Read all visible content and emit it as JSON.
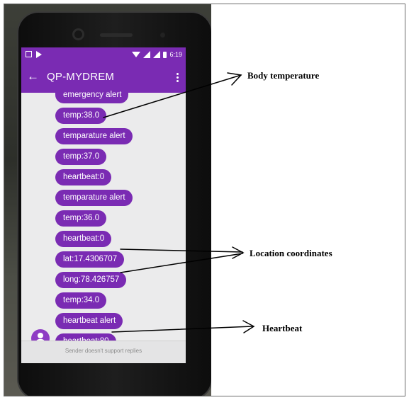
{
  "app": {
    "title": "QP-MYDREM",
    "clock": "6:19",
    "back_icon": "arrow-left-icon",
    "menu_icon": "more-vert-icon"
  },
  "messages": [
    "emergency alert",
    "temp:38.0",
    "temparature alert",
    "temp:37.0",
    "heartbeat:0",
    "temparature alert",
    "temp:36.0",
    "heartbeat:0",
    "lat:17.4306707",
    "long:78.426757",
    "temp:34.0",
    "heartbeat alert",
    "heartbeat:80"
  ],
  "footer": {
    "note": "Sender doesn't support replies"
  },
  "annotations": {
    "body_temperature": "Body temperature",
    "location_coordinates": "Location coordinates",
    "heartbeat": "Heartbeat"
  },
  "colors": {
    "accent": "#7a2bb3",
    "screen_bg": "#ebebec"
  }
}
